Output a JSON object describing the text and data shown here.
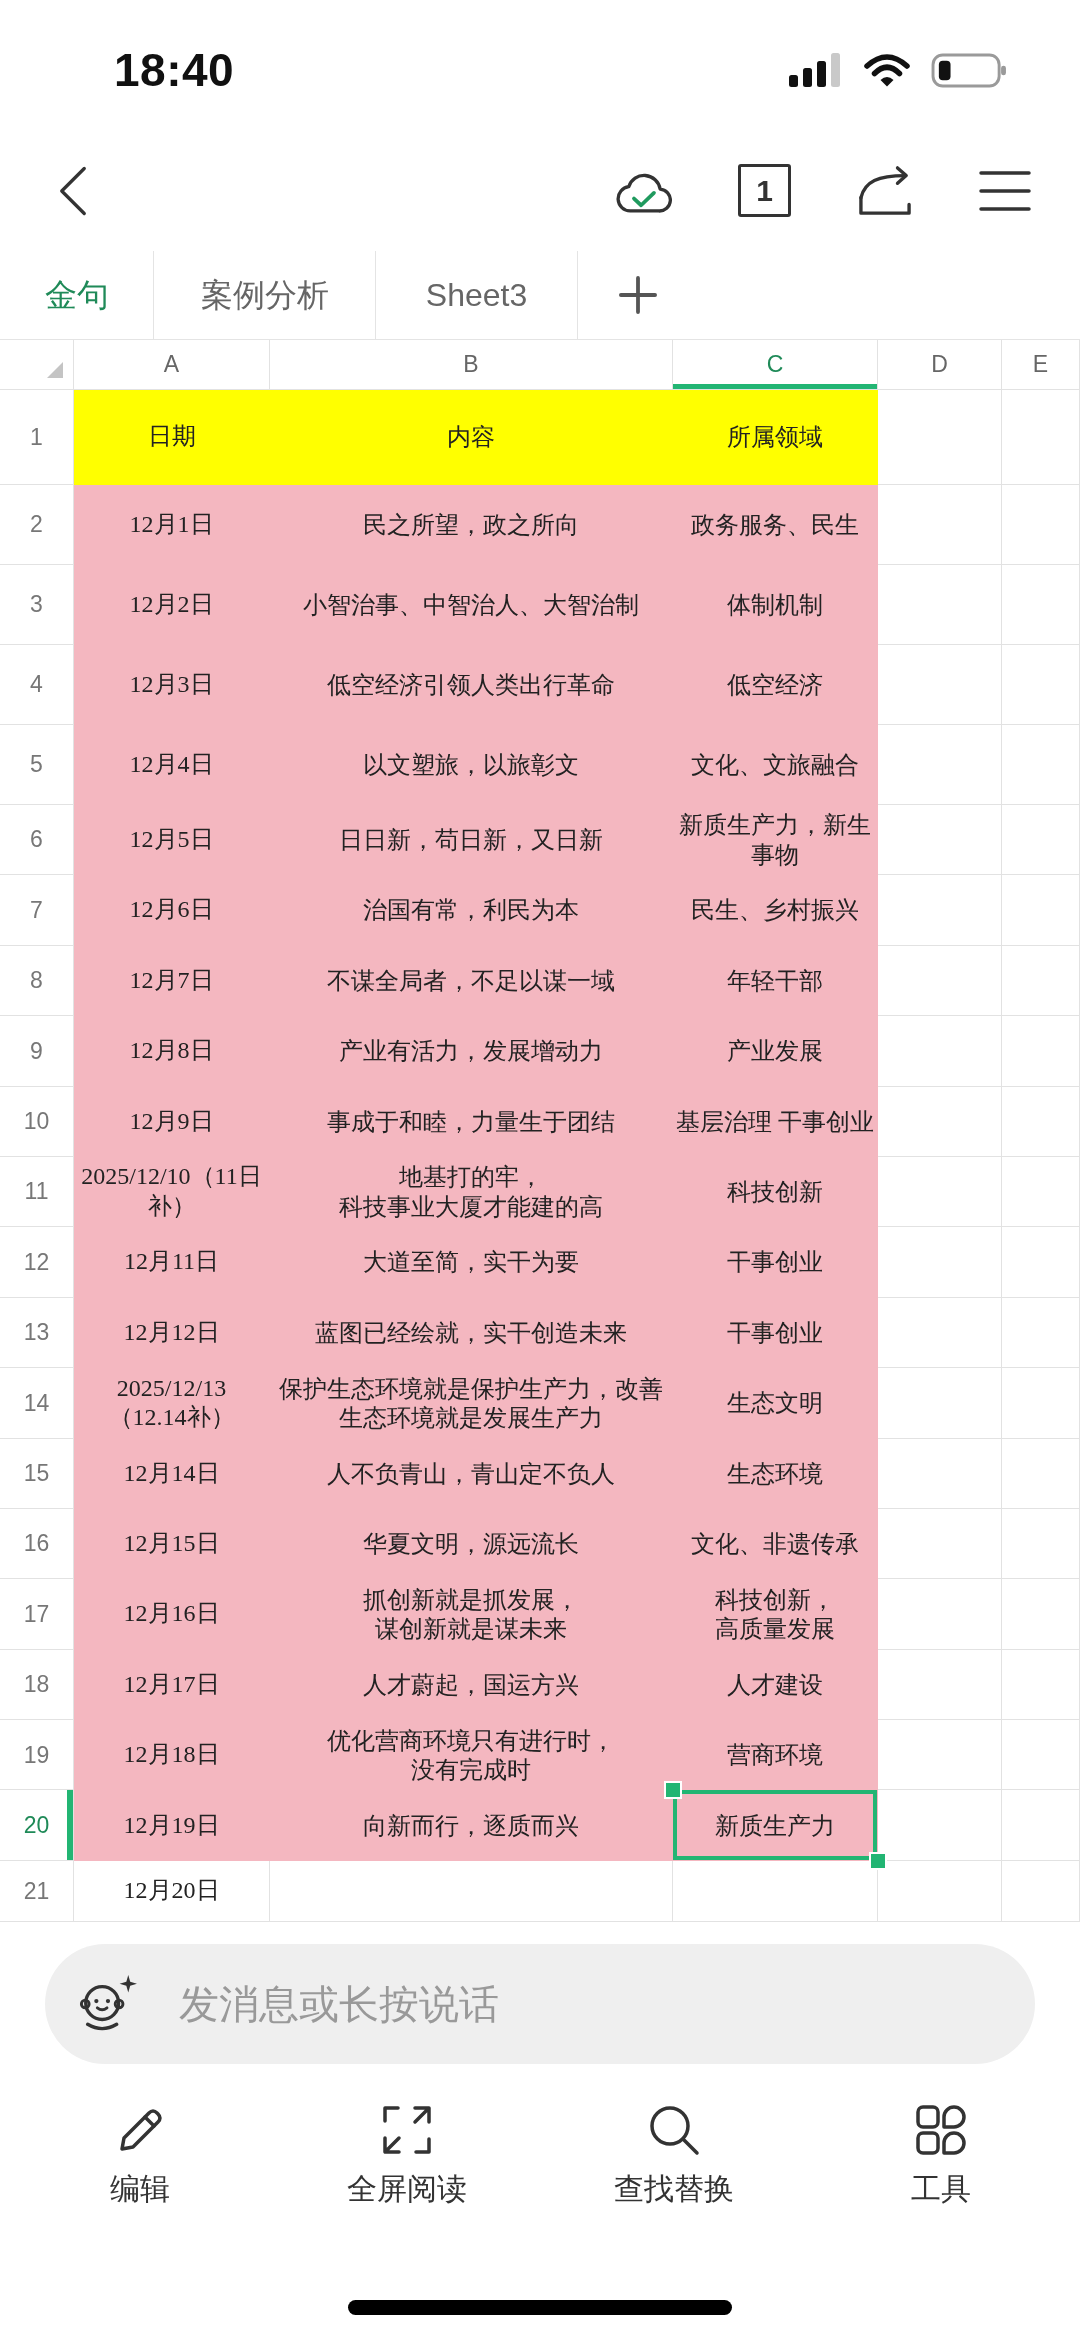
{
  "status_bar": {
    "time": "18:40"
  },
  "toolbar": {
    "page_count": "1"
  },
  "sheet_tabs": [
    {
      "label": "金句",
      "selected": true
    },
    {
      "label": "案例分析",
      "selected": false
    },
    {
      "label": "Sheet3",
      "selected": false
    }
  ],
  "sheet": {
    "columns": [
      {
        "label": "A",
        "selected": false
      },
      {
        "label": "B",
        "selected": false
      },
      {
        "label": "C",
        "selected": true
      },
      {
        "label": "D",
        "selected": false
      },
      {
        "label": "E",
        "selected": false
      }
    ],
    "rows": [
      {
        "number": "1",
        "selected": false,
        "color": "#ffff00",
        "cells": [
          "日期",
          "内容",
          "所属领域"
        ]
      },
      {
        "number": "2",
        "selected": false,
        "color": "#f4b7c0",
        "cells": [
          "12月1日",
          "民之所望，政之所向",
          "政务服务、民生"
        ]
      },
      {
        "number": "3",
        "selected": false,
        "color": "#f4b7c0",
        "cells": [
          "12月2日",
          "小智治事、中智治人、大智治制",
          "体制机制"
        ]
      },
      {
        "number": "4",
        "selected": false,
        "color": "#f4b7c0",
        "cells": [
          "12月3日",
          "低空经济引领人类出行革命",
          "低空经济"
        ]
      },
      {
        "number": "5",
        "selected": false,
        "color": "#f4b7c0",
        "cells": [
          "12月4日",
          "以文塑旅，以旅彰文",
          "文化、文旅融合"
        ]
      },
      {
        "number": "6",
        "selected": false,
        "color": "#f4b7c0",
        "cells": [
          "12月5日",
          "日日新，苟日新，又日新",
          "新质生产力，新生事物"
        ]
      },
      {
        "number": "7",
        "selected": false,
        "color": "#f4b7c0",
        "cells": [
          "12月6日",
          "治国有常，利民为本",
          "民生、乡村振兴"
        ]
      },
      {
        "number": "8",
        "selected": false,
        "color": "#f4b7c0",
        "cells": [
          "12月7日",
          "不谋全局者，不足以谋一域",
          "年轻干部"
        ]
      },
      {
        "number": "9",
        "selected": false,
        "color": "#f4b7c0",
        "cells": [
          "12月8日",
          "产业有活力，发展增动力",
          "产业发展"
        ]
      },
      {
        "number": "10",
        "selected": false,
        "color": "#f4b7c0",
        "cells": [
          "12月9日",
          "事成于和睦，力量生于团结",
          "基层治理 干事创业"
        ]
      },
      {
        "number": "11",
        "selected": false,
        "color": "#f4b7c0",
        "cells": [
          "2025/12/10（11日补）",
          [
            "地基打的牢，",
            "科技事业大厦才能建的高"
          ],
          "科技创新"
        ]
      },
      {
        "number": "12",
        "selected": false,
        "color": "#f4b7c0",
        "cells": [
          "12月11日",
          "大道至简，实干为要",
          "干事创业"
        ]
      },
      {
        "number": "13",
        "selected": false,
        "color": "#f4b7c0",
        "cells": [
          "12月12日",
          "蓝图已经绘就，实干创造未来",
          "干事创业"
        ]
      },
      {
        "number": "14",
        "selected": false,
        "color": "#f4b7c0",
        "cells": [
          "2025/12/13（12.14补）",
          "保护生态环境就是保护生产力，改善生态环境就是发展生产力",
          "生态文明"
        ]
      },
      {
        "number": "15",
        "selected": false,
        "color": "#f4b7c0",
        "cells": [
          "12月14日",
          "人不负青山，青山定不负人",
          "生态环境"
        ]
      },
      {
        "number": "16",
        "selected": false,
        "color": "#f4b7c0",
        "cells": [
          "12月15日",
          "华夏文明，源远流长",
          "文化、非遗传承"
        ]
      },
      {
        "number": "17",
        "selected": false,
        "color": "#f4b7c0",
        "cells": [
          "12月16日",
          [
            "抓创新就是抓发展，",
            "谋创新就是谋未来"
          ],
          [
            "科技创新，",
            "高质量发展"
          ]
        ]
      },
      {
        "number": "18",
        "selected": false,
        "color": "#f4b7c0",
        "cells": [
          "12月17日",
          "人才蔚起，国运方兴",
          "人才建设"
        ]
      },
      {
        "number": "19",
        "selected": false,
        "color": "#f4b7c0",
        "cells": [
          "12月18日",
          [
            "优化营商环境只有进行时，",
            "没有完成时"
          ],
          "营商环境"
        ]
      },
      {
        "number": "20",
        "selected": true,
        "color": "#f4b7c0",
        "cells": [
          "12月19日",
          "向新而行，逐质而兴",
          "新质生产力"
        ]
      },
      {
        "number": "21",
        "selected": false,
        "cells": [
          "12月20日"
        ]
      }
    ]
  },
  "message_bar": {
    "placeholder": "发消息或长按说话"
  },
  "bottom_nav": [
    {
      "label": "编辑",
      "kind": "edit"
    },
    {
      "label": "全屏阅读",
      "kind": "fullscreen"
    },
    {
      "label": "查找替换",
      "kind": "search"
    },
    {
      "label": "工具",
      "kind": "tools"
    }
  ]
}
